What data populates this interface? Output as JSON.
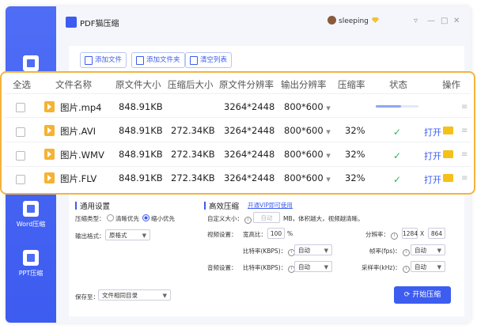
{
  "app": {
    "title": "PDF猫压缩",
    "user": "sleeping",
    "window_controls": [
      "▿",
      "—",
      "□",
      "✕"
    ]
  },
  "sidebar": {
    "items": [
      {
        "label": "",
        "icon": "pdf-compress-icon"
      },
      {
        "label": "Word压缩",
        "icon": "word-compress-icon"
      },
      {
        "label": "PPT压缩",
        "icon": "ppt-compress-icon"
      }
    ]
  },
  "toolbar": {
    "add_file": "添加文件",
    "add_folder": "添加文件夹",
    "clear_list": "清空列表"
  },
  "table": {
    "headers": {
      "select_all": "全选",
      "name": "文件名称",
      "orig_size": "原文件大小",
      "comp_size": "压缩后大小",
      "orig_res": "原文件分辨率",
      "out_res": "输出分辨率",
      "ratio": "压缩率",
      "status": "状态",
      "action": "操作"
    },
    "rows": [
      {
        "name": "图片.mp4",
        "orig_size": "848.91KB",
        "comp_size": "",
        "orig_res": "3264*2448",
        "out_res": "800*600",
        "ratio": "",
        "status": "progress",
        "progress": 0.6,
        "open": ""
      },
      {
        "name": "图片.AVI",
        "orig_size": "848.91KB",
        "comp_size": "272.34KB",
        "orig_res": "3264*2448",
        "out_res": "800*600",
        "ratio": "32%",
        "status": "done",
        "open": "打开"
      },
      {
        "name": "图片.WMV",
        "orig_size": "848.91KB",
        "comp_size": "272.34KB",
        "orig_res": "3264*2448",
        "out_res": "800*600",
        "ratio": "32%",
        "status": "done",
        "open": "打开"
      },
      {
        "name": "图片.FLV",
        "orig_size": "848.91KB",
        "comp_size": "272.34KB",
        "orig_res": "3264*2448",
        "out_res": "800*600",
        "ratio": "32%",
        "status": "done",
        "open": "打开"
      }
    ]
  },
  "general": {
    "title": "通用设置",
    "compress_type_label": "压缩类型：",
    "opt_clear": "清晰优先",
    "opt_small": "缩小优先",
    "selected": "opt_small",
    "output_format_label": "输出格式：",
    "output_format": "原格式"
  },
  "advanced": {
    "title": "高效压缩",
    "vip_link": "开通VIP即可使用",
    "custom_size_label": "自定义大小：",
    "custom_size_value": "自动",
    "custom_size_hint": "MB，体积越大，视频越清晰。",
    "video_label": "视频设置：",
    "width_ratio_label": "宽高比：",
    "width_ratio_value": "100",
    "width_ratio_unit": "%",
    "resolution_label": "分辨率：",
    "res_w": "1284",
    "res_x": "X",
    "res_h": "864",
    "bitrate_label": "比特率(KBPS)：",
    "bitrate_value": "自动",
    "fps_label": "帧率(fps)：",
    "fps_value": "自动",
    "audio_label": "音频设置：",
    "audio_bitrate_label": "比特率(KBPS)：",
    "audio_bitrate_value": "自动",
    "sample_rate_label": "采样率(kHz)：",
    "sample_rate_value": "自动"
  },
  "footer": {
    "save_to_label": "保存至：",
    "save_to_value": "文件相同目录",
    "start_button": "开始压缩"
  }
}
